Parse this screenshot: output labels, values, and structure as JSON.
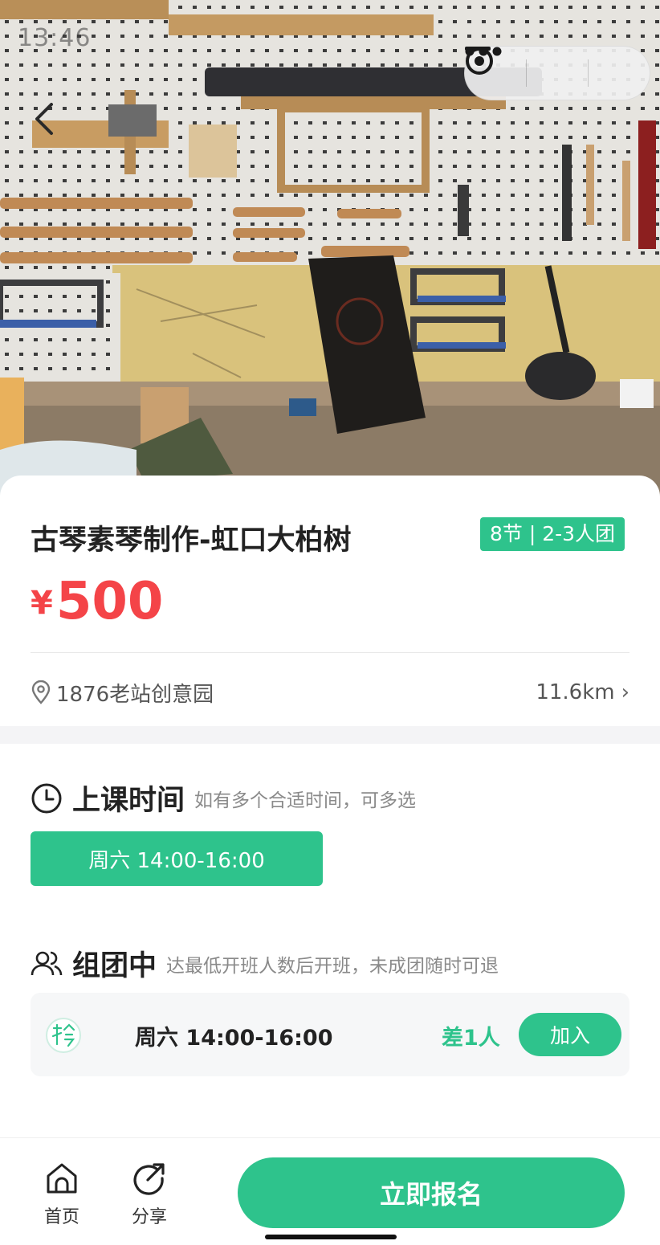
{
  "status": {
    "time": "13:46"
  },
  "header": {
    "back_icon": "chevron-left-icon",
    "capsule": [
      "more-icon",
      "minimize-icon",
      "close-target-icon"
    ]
  },
  "course": {
    "title": "古琴素琴制作-虹口大柏树",
    "tag": "8节 | 2-3人团",
    "price_currency": "¥",
    "price_value": "500",
    "location": "1876老站创意园",
    "distance": "11.6km",
    "chevron": "›"
  },
  "schedule": {
    "title": "上课时间",
    "subtitle": "如有多个合适时间，可多选",
    "slot": "周六 14:00-16:00"
  },
  "group": {
    "title": "组团中",
    "subtitle": "达最低开班人数后开班，未成团随时可退",
    "item": {
      "day": "周六",
      "time": "14:00-16:00",
      "need": "差1人",
      "join": "加入"
    }
  },
  "bottom_bar": {
    "home_label": "首页",
    "share_label": "分享",
    "signup_label": "立即报名"
  },
  "colors": {
    "accent": "#2ec38c",
    "price": "#f44448"
  }
}
